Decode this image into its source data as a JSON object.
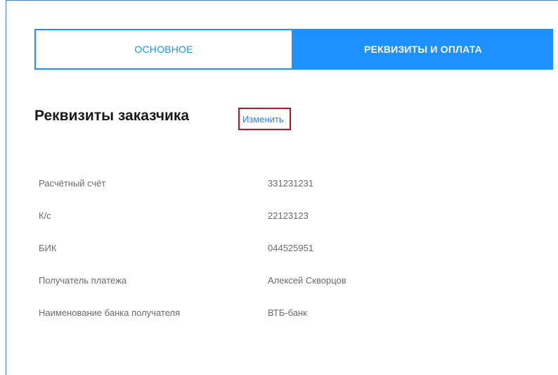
{
  "tabs": {
    "main_label": "ОСНОВНОЕ",
    "requisites_label": "РЕКВИЗИТЫ И ОПЛАТА",
    "active": "requisites"
  },
  "section": {
    "title": "Реквизиты заказчика",
    "edit_label": "Изменить"
  },
  "details": [
    {
      "label": "Расчётный счёт",
      "value": "331231231"
    },
    {
      "label": "К/с",
      "value": "22123123"
    },
    {
      "label": "БИК",
      "value": "044525951"
    },
    {
      "label": "Получатель платежа",
      "value": "Алексей Скворцов"
    },
    {
      "label": "Наименование банка получателя",
      "value": "ВТБ-банк"
    }
  ],
  "colors": {
    "accent": "#1e90ff",
    "link": "#2f7fe6",
    "highlight_border": "#b0182a",
    "text_muted": "#6a6a6a"
  }
}
